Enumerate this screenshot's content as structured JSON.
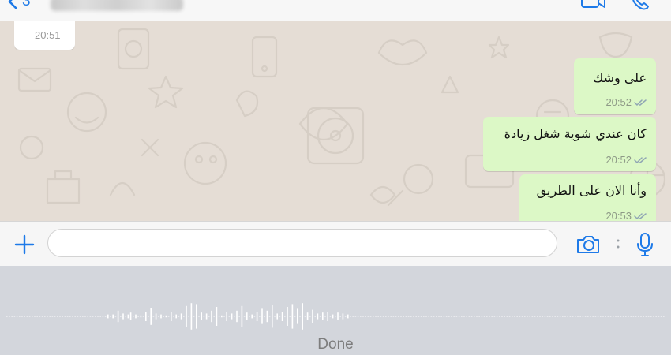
{
  "header": {
    "back_count": "3",
    "contact_name": "Lamia Almuhairi"
  },
  "messages": [
    {
      "direction": "in",
      "text": "",
      "time": "20:51"
    },
    {
      "direction": "out",
      "text": "على وشك",
      "time": "20:52",
      "status": "read"
    },
    {
      "direction": "out",
      "text": "كان عندي شوية شغل زيادة",
      "time": "20:52",
      "status": "read"
    },
    {
      "direction": "out",
      "text": "وأنا الان على الطريق",
      "time": "20:53",
      "status": "read"
    }
  ],
  "composer": {
    "placeholder": ""
  },
  "dictation": {
    "done_label": "Done",
    "bars": [
      2,
      0,
      2,
      0,
      6,
      0,
      3,
      0,
      2,
      4,
      0,
      2,
      0,
      1,
      0,
      5,
      0,
      9,
      0,
      3,
      0,
      2,
      0,
      1,
      0,
      5,
      0,
      2,
      0,
      3,
      0,
      11,
      0,
      14,
      0,
      13,
      0,
      4,
      0,
      3,
      0,
      6,
      0,
      10,
      0,
      1,
      0,
      5,
      0,
      3,
      0,
      6,
      0,
      11,
      0,
      4,
      0,
      2,
      0,
      5,
      0,
      8,
      0,
      6,
      0,
      12,
      0,
      3,
      0,
      5,
      0,
      10,
      0,
      13,
      0,
      8,
      0,
      14,
      0,
      4,
      0,
      7,
      0,
      3,
      0,
      4,
      0,
      5,
      0,
      2,
      0,
      4,
      0,
      3,
      0,
      2
    ]
  },
  "colors": {
    "accent": "#1e7ae8",
    "outgoing": "#dcf8c6",
    "incoming": "#ffffff",
    "read_ticks": "#4fb3e8"
  }
}
